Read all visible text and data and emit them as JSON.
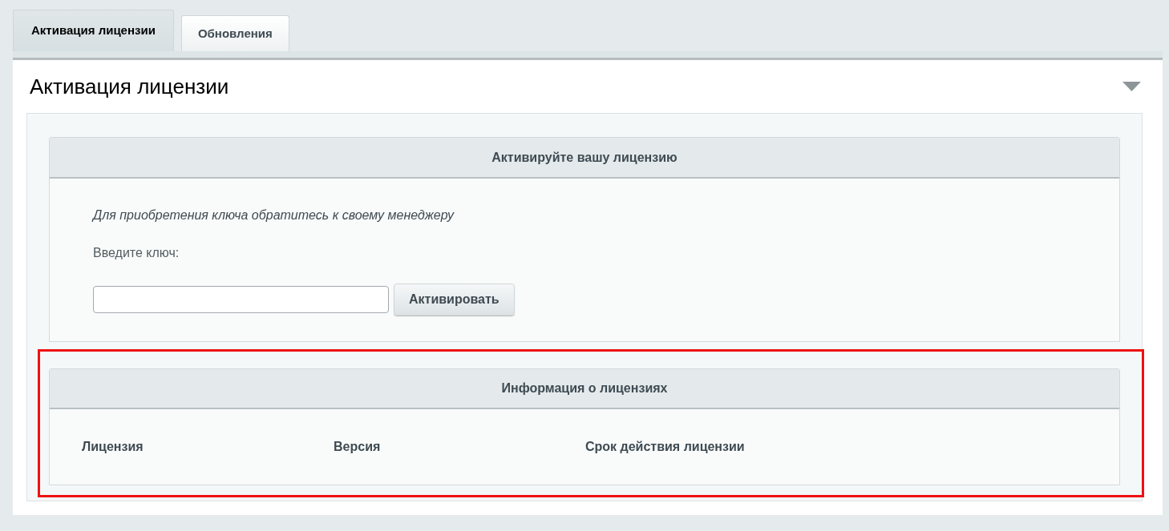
{
  "tabs": [
    {
      "label": "Активация лицензии",
      "selected": true
    },
    {
      "label": "Обновления",
      "selected": false
    }
  ],
  "panel": {
    "title": "Активация лицензии",
    "expanded": true
  },
  "activation_card": {
    "title": "Активируйте вашу лицензию",
    "hint": "Для приобретения ключа обратитесь к своему менеджеру",
    "key_label": "Введите ключ:",
    "button": "Активировать"
  },
  "license_card": {
    "title": "Информация о лицензиях",
    "columns": [
      "Лицензия",
      "Версия",
      "Срок действия лицензии"
    ],
    "highlighted": true
  }
}
